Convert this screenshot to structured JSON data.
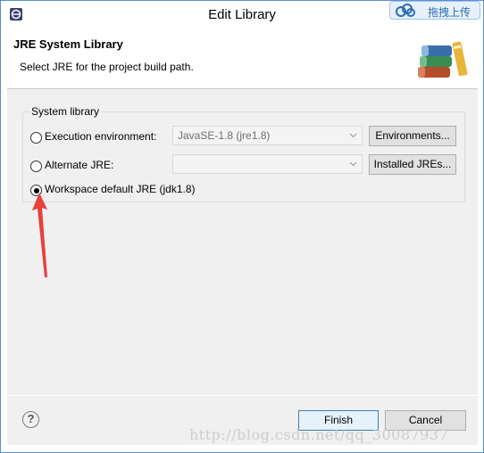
{
  "window": {
    "title": "Edit Library",
    "upload_label": "拖拽上传"
  },
  "header": {
    "title": "JRE System Library",
    "subtitle": "Select JRE for the project build path."
  },
  "group": {
    "label": "System library",
    "options": [
      {
        "label": "Execution environment:",
        "selected": false,
        "combo_value": "JavaSE-1.8 (jre1.8)",
        "button_label": "Environments..."
      },
      {
        "label": "Alternate JRE:",
        "selected": false,
        "combo_value": "",
        "button_label": "Installed JREs..."
      },
      {
        "label": "Workspace default JRE (jdk1.8)",
        "selected": true
      }
    ]
  },
  "footer": {
    "help_glyph": "?",
    "finish_label": "Finish",
    "cancel_label": "Cancel"
  },
  "watermark": "http://blog.csdn.net/qq_30087937",
  "colors": {
    "annotation_arrow": "#e8403a",
    "accent_border": "#3c7fb1",
    "dialog_bg": "#f0f0f0"
  }
}
